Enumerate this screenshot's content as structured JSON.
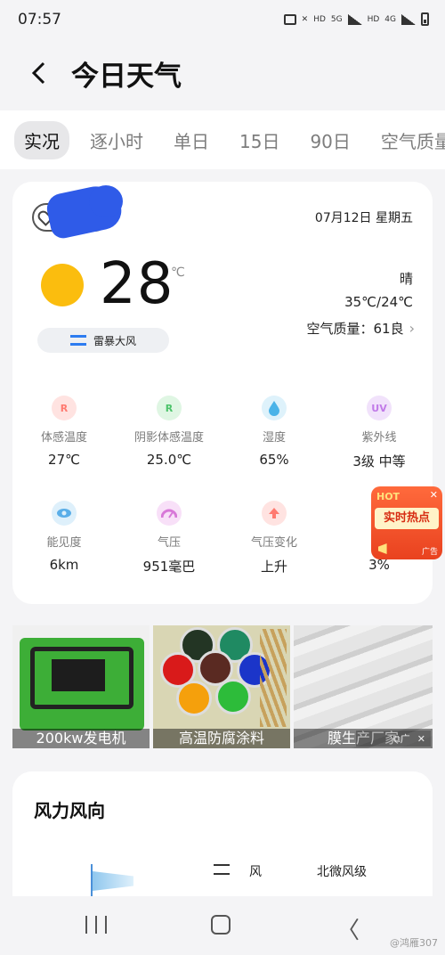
{
  "status_bar": {
    "time": "07:57",
    "icons": [
      "message-icon",
      "mute-icon",
      "hd-icon",
      "5g-icon",
      "signal-icon",
      "hd-icon",
      "4g-icon",
      "signal-icon",
      "battery-icon"
    ],
    "hd": "HD",
    "net1": "5G",
    "net2": "4G"
  },
  "header": {
    "title": "今日天气"
  },
  "tabs": [
    {
      "label": "实况",
      "active": true
    },
    {
      "label": "逐小时",
      "active": false
    },
    {
      "label": "单日",
      "active": false
    },
    {
      "label": "15日",
      "active": false
    },
    {
      "label": "90日",
      "active": false
    },
    {
      "label": "空气质量",
      "active": false
    }
  ],
  "weather": {
    "date": "07月12日 星期五",
    "temperature": "28",
    "unit": "℃",
    "alert": "雷暴大风",
    "condition": "晴",
    "range": "35℃/24℃",
    "aqi": "空气质量：61良"
  },
  "metrics": [
    {
      "label": "体感温度",
      "value": "27℃",
      "icon": "feels-like-icon",
      "icon_text": "R",
      "color": "#ff7a70",
      "bg": "#ffe3e1"
    },
    {
      "label": "阴影体感温度",
      "value": "25.0℃",
      "icon": "shade-feels-like-icon",
      "icon_text": "R",
      "color": "#4cc36a",
      "bg": "#dff6e3"
    },
    {
      "label": "湿度",
      "value": "65%",
      "icon": "humidity-icon",
      "icon_text": "",
      "color": "#4ab3e8",
      "bg": "#def2fb"
    },
    {
      "label": "紫外线",
      "value": "3级 中等",
      "icon": "uv-icon",
      "icon_text": "UV",
      "color": "#c17ae8",
      "bg": "#f1e2fb"
    },
    {
      "label": "能见度",
      "value": "6km",
      "icon": "visibility-icon",
      "icon_text": "",
      "color": "#5aaee8",
      "bg": "#def0fb"
    },
    {
      "label": "气压",
      "value": "951毫巴",
      "icon": "pressure-icon",
      "icon_text": "",
      "color": "#d878d8",
      "bg": "#f8e0f8"
    },
    {
      "label": "气压变化",
      "value": "上升",
      "icon": "pressure-change-icon",
      "icon_text": "",
      "color": "#ff7a70",
      "bg": "#ffe3e1"
    },
    {
      "label": "",
      "value": "3%",
      "icon": "rain-chance-icon",
      "icon_text": "",
      "color": "#ffffff",
      "bg": "#ffffff"
    }
  ],
  "ad_popup": {
    "head": "HOT",
    "main": "实时热点",
    "close": "✕",
    "tag": "广告"
  },
  "ads": [
    {
      "caption": "200kw发电机"
    },
    {
      "caption": "高温防腐涂料"
    },
    {
      "caption": "膜生产厂家"
    }
  ],
  "ad_tags": {
    "tag_glyph": "⧉广",
    "close": "✕"
  },
  "wind": {
    "title": "风力风向",
    "label": "风",
    "value": "北微风级"
  },
  "nav": {
    "back_glyph": "〈",
    "watermark": "@鸿雁307"
  }
}
